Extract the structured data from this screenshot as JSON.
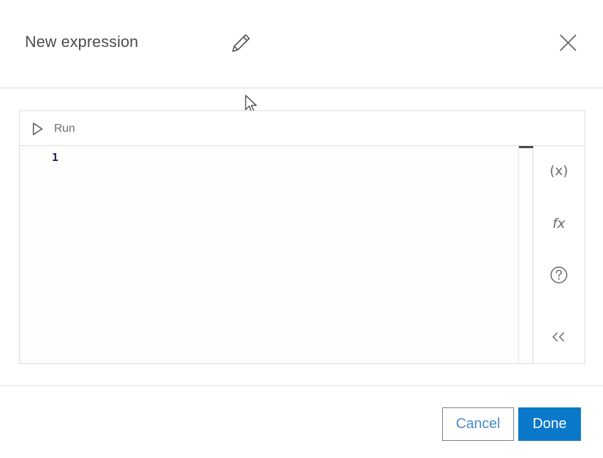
{
  "dialog": {
    "title": "New expression",
    "edit_title_icon": "pencil-icon",
    "close_icon": "close-icon"
  },
  "editor": {
    "toolbar": {
      "run_label": "Run",
      "run_icon": "play-icon"
    },
    "code": {
      "line_numbers": [
        "1"
      ],
      "content": ""
    },
    "side_panel": {
      "items": [
        {
          "name": "variables",
          "label": "(x)",
          "icon": "variables-icon"
        },
        {
          "name": "functions",
          "label": "fx",
          "icon": "functions-icon"
        },
        {
          "name": "help",
          "label": "",
          "icon": "help-circle-icon"
        },
        {
          "name": "collapse",
          "label": "",
          "icon": "chevrons-left-icon"
        }
      ]
    }
  },
  "footer": {
    "cancel_label": "Cancel",
    "done_label": "Done"
  },
  "colors": {
    "accent": "#0a79c9",
    "cancel_text": "#4a8cc4",
    "border": "#dcdcdc",
    "editor_bg": "#fdfdfb"
  }
}
